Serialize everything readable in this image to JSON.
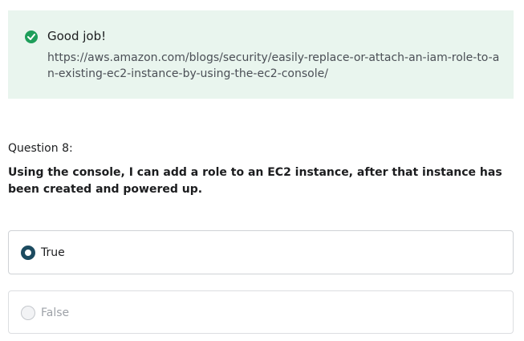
{
  "feedback": {
    "icon": "check-circle-icon",
    "color": "#1e9e5a",
    "title": "Good job!",
    "link": "https://aws.amazon.com/blogs/security/easily-replace-or-attach-an-iam-role-to-an-existing-ec2-instance-by-using-the-ec2-console/"
  },
  "question": {
    "number_label": "Question 8:",
    "text": "Using the console, I can add a role to an EC2 instance, after that instance has been created and powered up."
  },
  "options": [
    {
      "label": "True",
      "selected": true
    },
    {
      "label": "False",
      "selected": false
    }
  ]
}
